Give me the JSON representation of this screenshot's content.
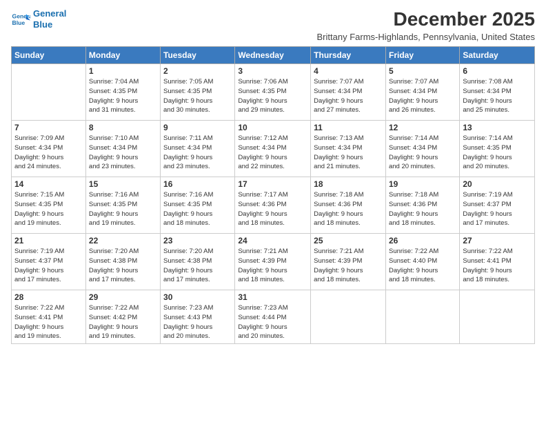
{
  "logo": {
    "line1": "General",
    "line2": "Blue"
  },
  "title": "December 2025",
  "subtitle": "Brittany Farms-Highlands, Pennsylvania, United States",
  "headers": [
    "Sunday",
    "Monday",
    "Tuesday",
    "Wednesday",
    "Thursday",
    "Friday",
    "Saturday"
  ],
  "weeks": [
    [
      {
        "day": "",
        "info": ""
      },
      {
        "day": "1",
        "info": "Sunrise: 7:04 AM\nSunset: 4:35 PM\nDaylight: 9 hours\nand 31 minutes."
      },
      {
        "day": "2",
        "info": "Sunrise: 7:05 AM\nSunset: 4:35 PM\nDaylight: 9 hours\nand 30 minutes."
      },
      {
        "day": "3",
        "info": "Sunrise: 7:06 AM\nSunset: 4:35 PM\nDaylight: 9 hours\nand 29 minutes."
      },
      {
        "day": "4",
        "info": "Sunrise: 7:07 AM\nSunset: 4:34 PM\nDaylight: 9 hours\nand 27 minutes."
      },
      {
        "day": "5",
        "info": "Sunrise: 7:07 AM\nSunset: 4:34 PM\nDaylight: 9 hours\nand 26 minutes."
      },
      {
        "day": "6",
        "info": "Sunrise: 7:08 AM\nSunset: 4:34 PM\nDaylight: 9 hours\nand 25 minutes."
      }
    ],
    [
      {
        "day": "7",
        "info": "Sunrise: 7:09 AM\nSunset: 4:34 PM\nDaylight: 9 hours\nand 24 minutes."
      },
      {
        "day": "8",
        "info": "Sunrise: 7:10 AM\nSunset: 4:34 PM\nDaylight: 9 hours\nand 23 minutes."
      },
      {
        "day": "9",
        "info": "Sunrise: 7:11 AM\nSunset: 4:34 PM\nDaylight: 9 hours\nand 23 minutes."
      },
      {
        "day": "10",
        "info": "Sunrise: 7:12 AM\nSunset: 4:34 PM\nDaylight: 9 hours\nand 22 minutes."
      },
      {
        "day": "11",
        "info": "Sunrise: 7:13 AM\nSunset: 4:34 PM\nDaylight: 9 hours\nand 21 minutes."
      },
      {
        "day": "12",
        "info": "Sunrise: 7:14 AM\nSunset: 4:34 PM\nDaylight: 9 hours\nand 20 minutes."
      },
      {
        "day": "13",
        "info": "Sunrise: 7:14 AM\nSunset: 4:35 PM\nDaylight: 9 hours\nand 20 minutes."
      }
    ],
    [
      {
        "day": "14",
        "info": "Sunrise: 7:15 AM\nSunset: 4:35 PM\nDaylight: 9 hours\nand 19 minutes."
      },
      {
        "day": "15",
        "info": "Sunrise: 7:16 AM\nSunset: 4:35 PM\nDaylight: 9 hours\nand 19 minutes."
      },
      {
        "day": "16",
        "info": "Sunrise: 7:16 AM\nSunset: 4:35 PM\nDaylight: 9 hours\nand 18 minutes."
      },
      {
        "day": "17",
        "info": "Sunrise: 7:17 AM\nSunset: 4:36 PM\nDaylight: 9 hours\nand 18 minutes."
      },
      {
        "day": "18",
        "info": "Sunrise: 7:18 AM\nSunset: 4:36 PM\nDaylight: 9 hours\nand 18 minutes."
      },
      {
        "day": "19",
        "info": "Sunrise: 7:18 AM\nSunset: 4:36 PM\nDaylight: 9 hours\nand 18 minutes."
      },
      {
        "day": "20",
        "info": "Sunrise: 7:19 AM\nSunset: 4:37 PM\nDaylight: 9 hours\nand 17 minutes."
      }
    ],
    [
      {
        "day": "21",
        "info": "Sunrise: 7:19 AM\nSunset: 4:37 PM\nDaylight: 9 hours\nand 17 minutes."
      },
      {
        "day": "22",
        "info": "Sunrise: 7:20 AM\nSunset: 4:38 PM\nDaylight: 9 hours\nand 17 minutes."
      },
      {
        "day": "23",
        "info": "Sunrise: 7:20 AM\nSunset: 4:38 PM\nDaylight: 9 hours\nand 17 minutes."
      },
      {
        "day": "24",
        "info": "Sunrise: 7:21 AM\nSunset: 4:39 PM\nDaylight: 9 hours\nand 18 minutes."
      },
      {
        "day": "25",
        "info": "Sunrise: 7:21 AM\nSunset: 4:39 PM\nDaylight: 9 hours\nand 18 minutes."
      },
      {
        "day": "26",
        "info": "Sunrise: 7:22 AM\nSunset: 4:40 PM\nDaylight: 9 hours\nand 18 minutes."
      },
      {
        "day": "27",
        "info": "Sunrise: 7:22 AM\nSunset: 4:41 PM\nDaylight: 9 hours\nand 18 minutes."
      }
    ],
    [
      {
        "day": "28",
        "info": "Sunrise: 7:22 AM\nSunset: 4:41 PM\nDaylight: 9 hours\nand 19 minutes."
      },
      {
        "day": "29",
        "info": "Sunrise: 7:22 AM\nSunset: 4:42 PM\nDaylight: 9 hours\nand 19 minutes."
      },
      {
        "day": "30",
        "info": "Sunrise: 7:23 AM\nSunset: 4:43 PM\nDaylight: 9 hours\nand 20 minutes."
      },
      {
        "day": "31",
        "info": "Sunrise: 7:23 AM\nSunset: 4:44 PM\nDaylight: 9 hours\nand 20 minutes."
      },
      {
        "day": "",
        "info": ""
      },
      {
        "day": "",
        "info": ""
      },
      {
        "day": "",
        "info": ""
      }
    ]
  ]
}
